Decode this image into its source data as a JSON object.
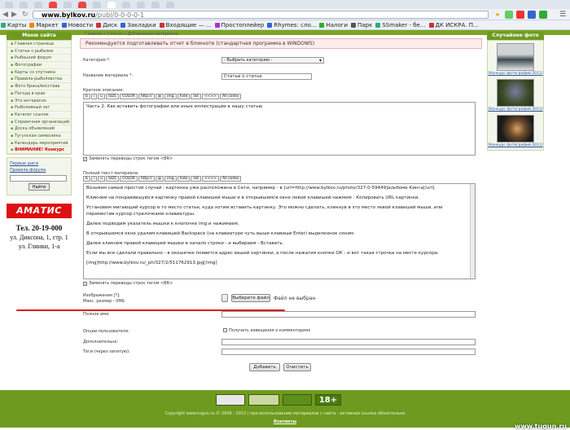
{
  "browser": {
    "url_host": "www.bylkov.ru",
    "url_path": "/publ/0-0-0-0-1",
    "bookmarks": [
      "Карты",
      "Маркет",
      "Новости",
      "Диск",
      "Закладки",
      "Входящие — ...",
      "Простоплейер",
      "Rhymes: сло...",
      "Налоги",
      "Парк",
      "SSmaker - бе...",
      "ДК ИСКРА. П..."
    ]
  },
  "left": {
    "menu_title": "Меню сайта",
    "menu": [
      "Главная страница",
      "Статьи о рыбалке",
      "Рыбацкий форум",
      "Фотографии",
      "Карты со спутника",
      "Правила рыболовства",
      "Фото брака/восстава",
      "Погода в крае",
      "Это интересно",
      "Рыболовный чат",
      "Каталог ссылок",
      "Справочник организаций",
      "Доска объявлений",
      "Тугунская символика",
      "Календарь мероприятий",
      "ВНИМАНИЕ! Конкурс"
    ],
    "login_links": [
      "Первые шаги",
      "Правила форума"
    ],
    "login_button": "Найти",
    "ad_brand": "АМАТИС",
    "ad_lines": [
      "Тел. 20-19-000",
      "ул. Диксона, 1, стр. 1",
      "ул. Глинки, 1-а"
    ]
  },
  "main": {
    "breadcrumb": "Главная » Статьи » Добавление материала",
    "notice": "Рекомендуется подготавливать отчет в блокноте (стандартная программа в WINDOWS)",
    "category_label": "Категория *:",
    "category_value": "- Выбрать категорию -",
    "title_label": "Название материала *:",
    "title_value": "Статьи о статье",
    "brief_label": "Краткое описание:",
    "brief_value": "Часть 2. Как вставить фотографии или иные иллюстрации в нашу статью",
    "toolbar": [
      "b",
      "i",
      "u",
      "SIZE",
      "COLOR",
      "http://",
      "@",
      "img",
      "hide",
      "list",
      "<<>>",
      "All codes"
    ],
    "newline_check": "Заменять переводы строк тегом <BR>",
    "full_label": "Полный текст материала:",
    "full_lines": [
      "Возьмем самый простой случай - картинка уже расположена в Сети, например - в [url=http://www.bylkov.ru/photo/327-0-59449]альбоме Кинга[/url].",
      "Кликнем на понравившуюся картинку правой клавишей мыши и в открывшемся окне левой клавишей нажмем - Копировать URL картинки.",
      "Установим мигающий курсор в то место статьи, куда хотим вставить картинку. Это можно сделать, кликнув в это место левой клавишей мыши, или переместив курсор стрелочками клавиатуры.",
      "Далее подводим указатель мышки к кнопочке img и нажимаем.",
      "В открывшемся окне удалим клавишей Backspace (на клавиатуре чуть выше клавиши Enter) выделенное синим.",
      "Далее кликнем правой клавишей мышки в начало строки - и выбираем - Вставить.",
      "Если мы все сделали правильно - в окошечке появится адрес вашей картинки, а после нажатия кнопки ОК - и вот такая строчка на месте курсора:",
      "[img]http://www.bylkov.ru/_ph/327/2/511762913.jpg[/img]"
    ],
    "image_label": "Изображения [?]:",
    "image_sub": "Макс. размер - 0Mb",
    "file_button": "Выберите файл",
    "file_status": "Файл не выбран",
    "author_label": "Полное имя:",
    "options_label": "Опции пользователя:",
    "notify_check": "Получать извещения о комментариях",
    "extra_label": "Дополнительно:",
    "tags_label": "Теги (через запятую):",
    "submit_button": "Добавить",
    "reset_button": "Очистить"
  },
  "right": {
    "title": "Случайное фото",
    "captions": [
      "[Конкурс фотографий 2011]",
      "[Конкурс фотографий 2011]",
      "[Конкурс фотографий 2011]"
    ]
  },
  "footer": {
    "badge": "18+",
    "copyright": "Copyright www.tugun.ru © 2008 - 2012 | при использовании материалов с сайта - активная ссылка обязательна",
    "contacts": "Контакты",
    "watermark": "www.tugun.ru"
  },
  "colors": {
    "accent": "#6e9b1f",
    "annotation": "#e01010",
    "notice_bg": "#fdecec"
  }
}
